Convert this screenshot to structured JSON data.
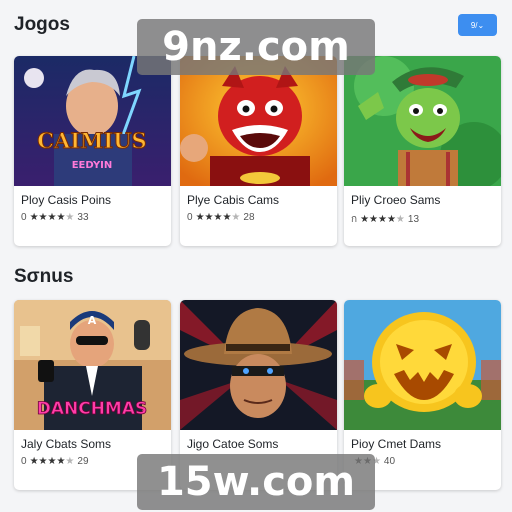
{
  "sections": [
    {
      "title": "Jogos"
    },
    {
      "title": "Sσnus"
    }
  ],
  "top_button": {
    "label": "9/⌄",
    "icon": "chevron-down-icon"
  },
  "cards": [
    {
      "title": "Ploy Casis Poins",
      "meta_left": "0",
      "rating": "★★★★",
      "meta_right": "33",
      "art_text": "CAIMIUS",
      "art_sub": "EEDYIN"
    },
    {
      "title": "Plye Cabis Cams",
      "meta_left": "0",
      "rating": "★★★★",
      "meta_right": "28"
    },
    {
      "title": "Pliy Croeo Sams",
      "meta_left": "ก",
      "rating": "★★★★",
      "meta_right": "13"
    },
    {
      "title": "Jaly Cbats Soms",
      "meta_left": "0",
      "rating": "★★★★",
      "meta_right": "29",
      "art_text": "DANCHMAS"
    },
    {
      "title": "Jigo Catoe Soms",
      "meta_left": "",
      "rating": "",
      "meta_right": ""
    },
    {
      "title": "Pioy Cmet Dams",
      "meta_left": "",
      "rating": "★★",
      "meta_right": "40"
    }
  ],
  "watermarks": {
    "top": "9nz.com",
    "bottom": "15w.com"
  },
  "colors": {
    "accent": "#3d8ef0",
    "card_bg": "#ffffff",
    "page_bg": "#f4f5f7"
  }
}
